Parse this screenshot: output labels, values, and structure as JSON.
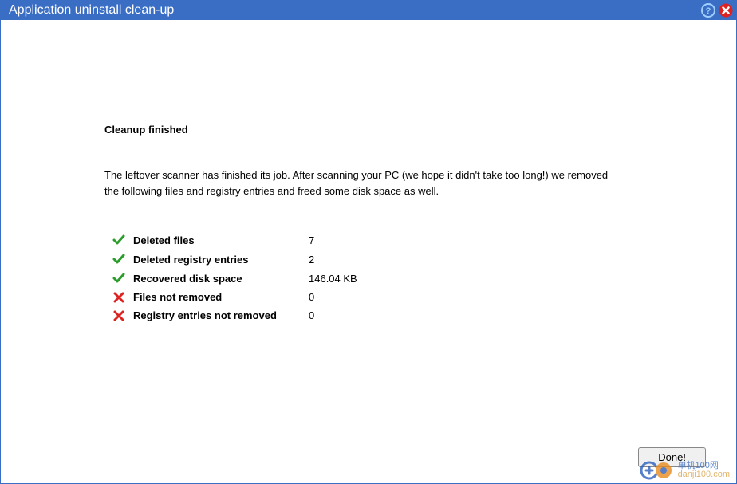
{
  "titlebar": {
    "title": "Application uninstall clean-up"
  },
  "main": {
    "heading": "Cleanup finished",
    "description": "The leftover scanner has finished its job. After scanning your PC (we hope it didn't take too long!) we removed the following files and registry entries and freed some disk space as well.",
    "stats": [
      {
        "status": "ok",
        "label": "Deleted files",
        "value": "7"
      },
      {
        "status": "ok",
        "label": "Deleted registry entries",
        "value": "2"
      },
      {
        "status": "ok",
        "label": "Recovered disk space",
        "value": "146.04 KB"
      },
      {
        "status": "fail",
        "label": "Files not removed",
        "value": "0"
      },
      {
        "status": "fail",
        "label": "Registry entries not removed",
        "value": "0"
      }
    ],
    "done_label": "Done!"
  },
  "watermark": {
    "line1": "单机100网",
    "line2": "danji100.com"
  }
}
